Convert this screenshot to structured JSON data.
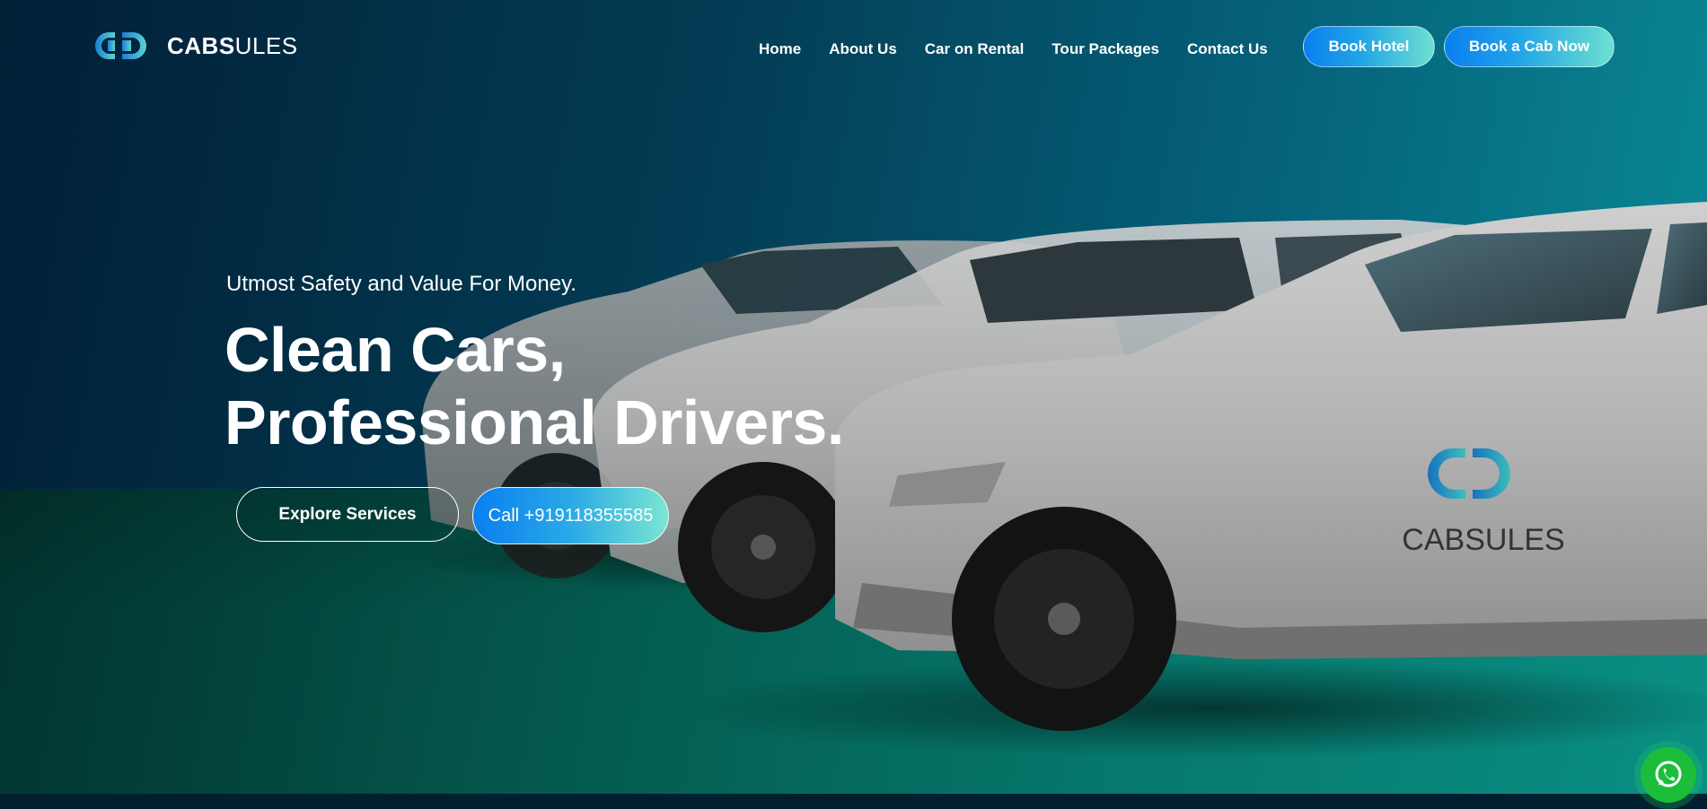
{
  "brand": {
    "name_bold": "CABS",
    "name_light": "ULES",
    "accent_start": "#1a7fd4",
    "accent_end": "#5ad4d0"
  },
  "nav": {
    "items": [
      {
        "label": "Home"
      },
      {
        "label": "About Us"
      },
      {
        "label": "Car on Rental"
      },
      {
        "label": "Tour Packages"
      },
      {
        "label": "Contact Us"
      }
    ]
  },
  "header_buttons": {
    "book_hotel": "Book Hotel",
    "book_cab": "Book a Cab Now"
  },
  "hero": {
    "tagline": "Utmost Safety and Value For Money.",
    "headline_line1": "Clean Cars,",
    "headline_line2": "Professional Drivers.",
    "explore_button": "Explore Services",
    "call_button": "Call +919118355585"
  },
  "car_decal": {
    "text": "CABSULES"
  },
  "floating": {
    "icon": "whatsapp-icon"
  }
}
